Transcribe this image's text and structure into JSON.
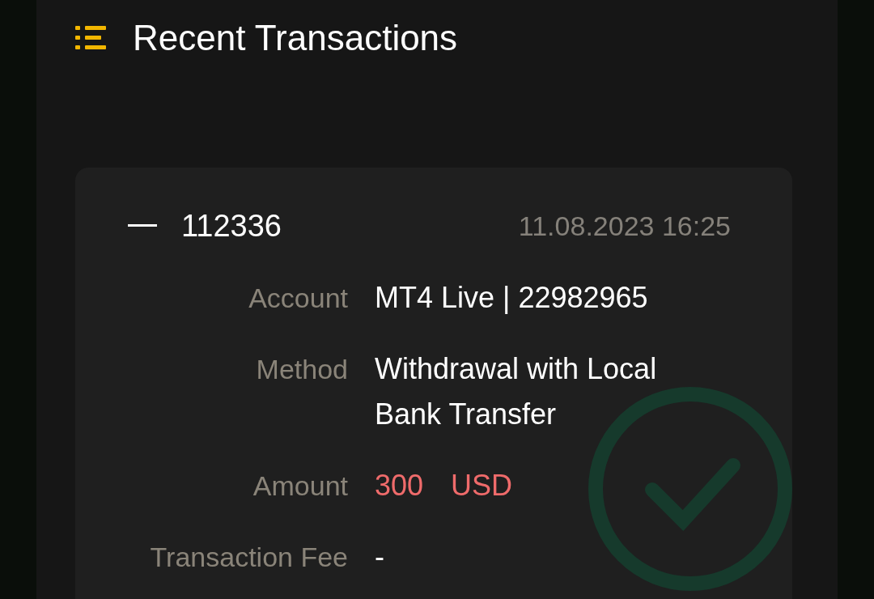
{
  "header": {
    "title": "Recent Transactions"
  },
  "transactions": [
    {
      "id": "112336",
      "expanded": true,
      "date": "11.08.2023 16:25",
      "completed": true,
      "fields": [
        {
          "kind": "text",
          "label": "Account",
          "value": "MT4 Live | 22982965"
        },
        {
          "kind": "text",
          "label": "Method",
          "value": "Withdrawal with Local Bank Transfer"
        },
        {
          "kind": "amount",
          "label": "Amount",
          "value": "300",
          "currency": "USD"
        },
        {
          "kind": "text",
          "label": "Transaction Fee",
          "value": "-"
        }
      ]
    }
  ]
}
